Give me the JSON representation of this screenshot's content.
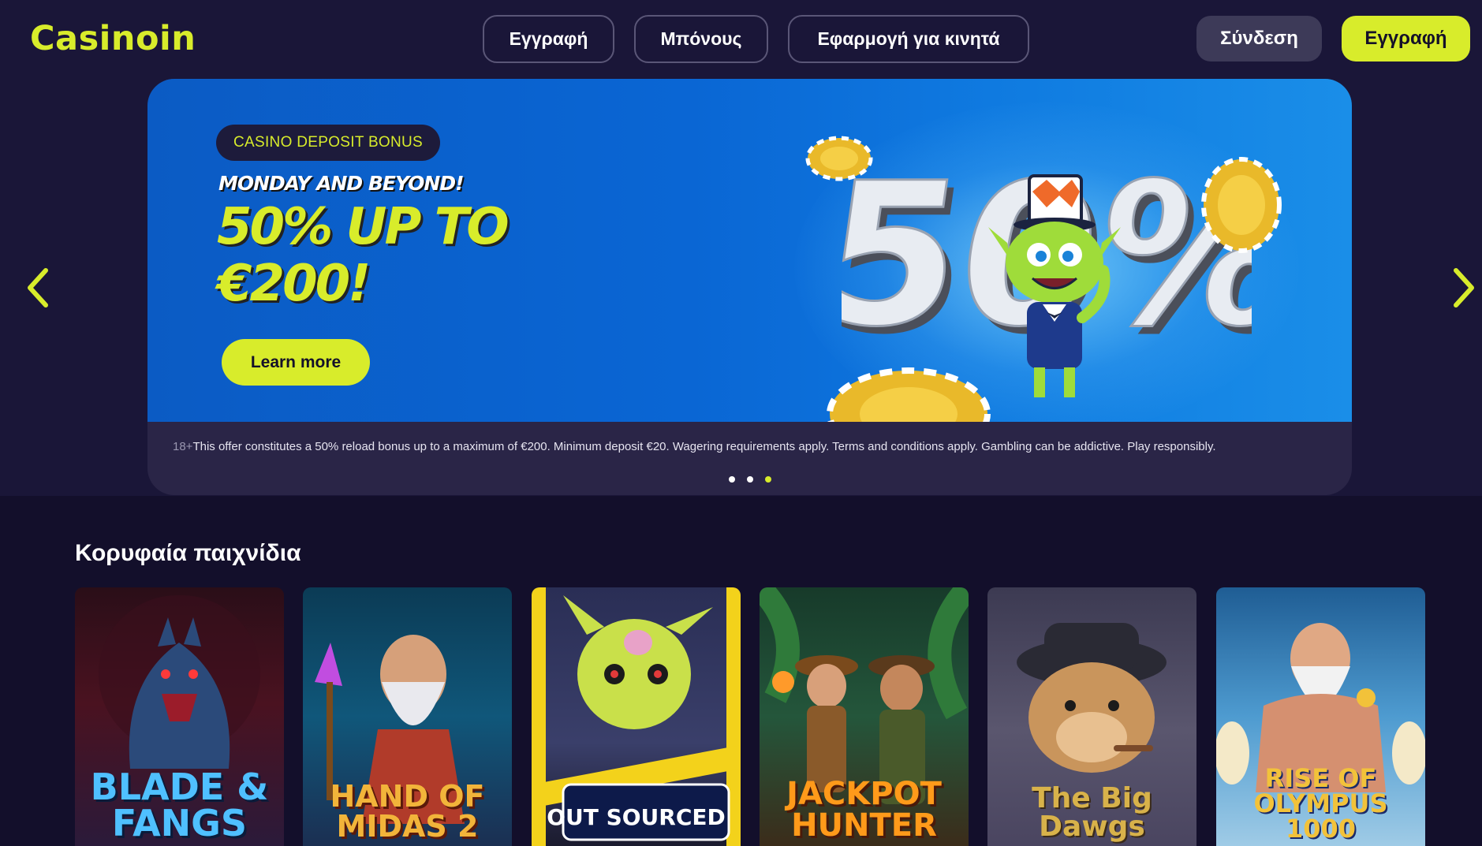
{
  "header": {
    "logo": "Casinoin",
    "nav": [
      "Εγγραφή",
      "Μπόνους",
      "Εφαρμογή για κινητά"
    ],
    "login_label": "Σύνδεση",
    "signup_label": "Εγγραφή"
  },
  "banner": {
    "badge": "CASINO DEPOSIT BONUS",
    "subline": "MONDAY AND BEYOND!",
    "headline_line1": "50% UP TO",
    "headline_line2": "€200!",
    "cta_label": "Learn more",
    "art_text": "50%",
    "disclaimer_age": "18+",
    "disclaimer": "This offer constitutes a 50% reload bonus up to a maximum of €200. Minimum deposit €20. Wagering requirements apply. Terms and conditions apply. Gambling can be addictive. Play responsibly.",
    "slides_total": 3,
    "active_slide": 3
  },
  "games_section": {
    "title": "Κορυφαία παιχνίδια",
    "games": [
      {
        "name": "BLADE & FANGS"
      },
      {
        "name": "HAND OF MIDAS 2"
      },
      {
        "name": "OUT SOURCED"
      },
      {
        "name": "JACKPOT HUNTER"
      },
      {
        "name": "The Big Dawgs"
      },
      {
        "name": "RISE OF OLYMPUS 1000"
      }
    ]
  },
  "colors": {
    "accent": "#d8ec2b",
    "header_bg": "#1a1638",
    "page_bg": "#130f2b",
    "banner_blue": "#0a66d4"
  }
}
